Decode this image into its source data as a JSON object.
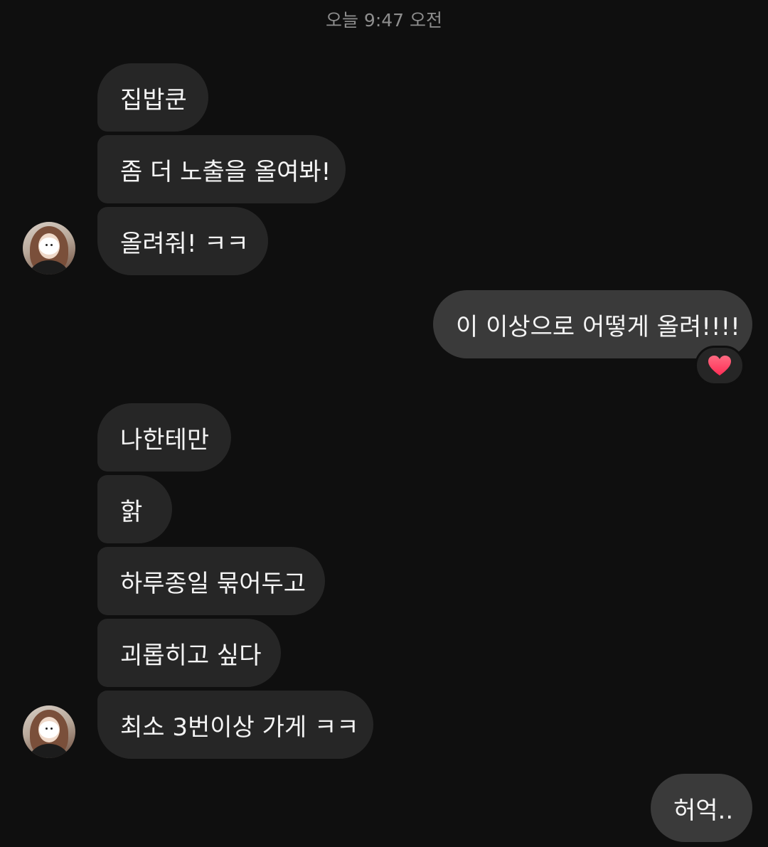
{
  "header": {
    "timestamp": "오늘 9:47 오전"
  },
  "messages": [
    {
      "id": "m1",
      "direction": "incoming",
      "text": "집밥쿤"
    },
    {
      "id": "m2",
      "direction": "incoming",
      "text": "좀 더 노출을 올여봐!"
    },
    {
      "id": "m3",
      "direction": "incoming",
      "text": "올려줘! ㅋㅋ"
    },
    {
      "id": "m4",
      "direction": "outgoing",
      "text": "이 이상으로 어떻게 올려!!!!",
      "reaction": "heart-icon"
    },
    {
      "id": "m5",
      "direction": "incoming",
      "text": "나한테만"
    },
    {
      "id": "m6",
      "direction": "incoming",
      "text": "핡"
    },
    {
      "id": "m7",
      "direction": "incoming",
      "text": "하루종일 묶어두고"
    },
    {
      "id": "m8",
      "direction": "incoming",
      "text": "괴롭히고 싶다"
    },
    {
      "id": "m9",
      "direction": "incoming",
      "text": "최소 3번이상 가게 ㅋㅋ"
    },
    {
      "id": "m10",
      "direction": "outgoing",
      "text": "허억.."
    }
  ],
  "colors": {
    "background": "#0f0f0f",
    "incoming_bubble": "#262626",
    "outgoing_bubble": "#3a3a3a",
    "timestamp_text": "#8e8e8e",
    "heart": "#ff3b5c"
  }
}
